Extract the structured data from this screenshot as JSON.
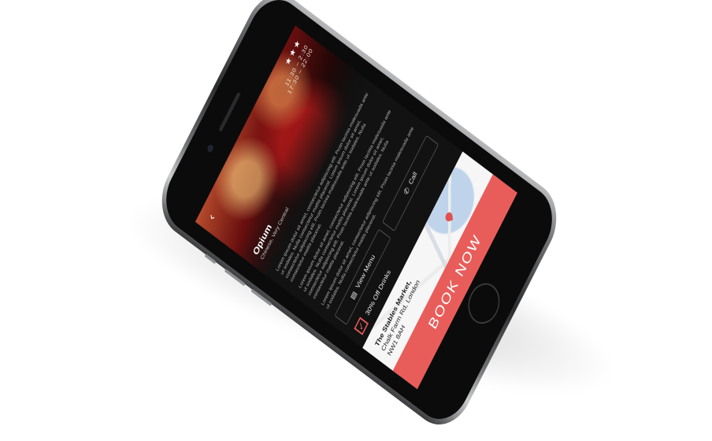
{
  "header": {
    "rating": "★★★",
    "hours": [
      "11:30 – 2:30",
      "17:30 – 22:00"
    ]
  },
  "venue": {
    "name": "Opium",
    "subtitle": "Chinese, Very Central"
  },
  "description": [
    "Lorem ipsum dolor sit amet, consectetur adipiscing elit. Proin lacinia malesuada ante ut sodales. Nulla consectetur mattis placerat. Lorem ipsum dolor sit amet, consectetur adipiscing elit. Proin lacinia malesuada ante ut sodales. Nulla consectetur mattis placerat.",
    "Lorem ipsum dolor sit amet, consectetur adipiscing elit. Proin lacinia malesuada ante ut sodales. Nulla consectetur mattis placerat. Lorem ipsum dolor sit amet, consectetur adipiscing elit. Proin lacinia malesuada ante ut sodales. Nulla consectetur mattis placerat.",
    "Lorem ipsum dolor sit amet, consectetur adipiscing elit. Proin lacinia malesuada ante ut sodales. Nulla consectetur mattis placerat."
  ],
  "actions": {
    "menu_label": "View Menu",
    "call_label": "Call"
  },
  "offer": {
    "text": "30% Off Drinks"
  },
  "map": {
    "address_title": "The Stables Market,",
    "address_line1": "Chalk Farm Rd, London",
    "address_line2": "NW1 8AH"
  },
  "cta": {
    "label": "BOOK NOW"
  },
  "colors": {
    "accent": "#e85d5a",
    "screen_bg": "#121212"
  }
}
